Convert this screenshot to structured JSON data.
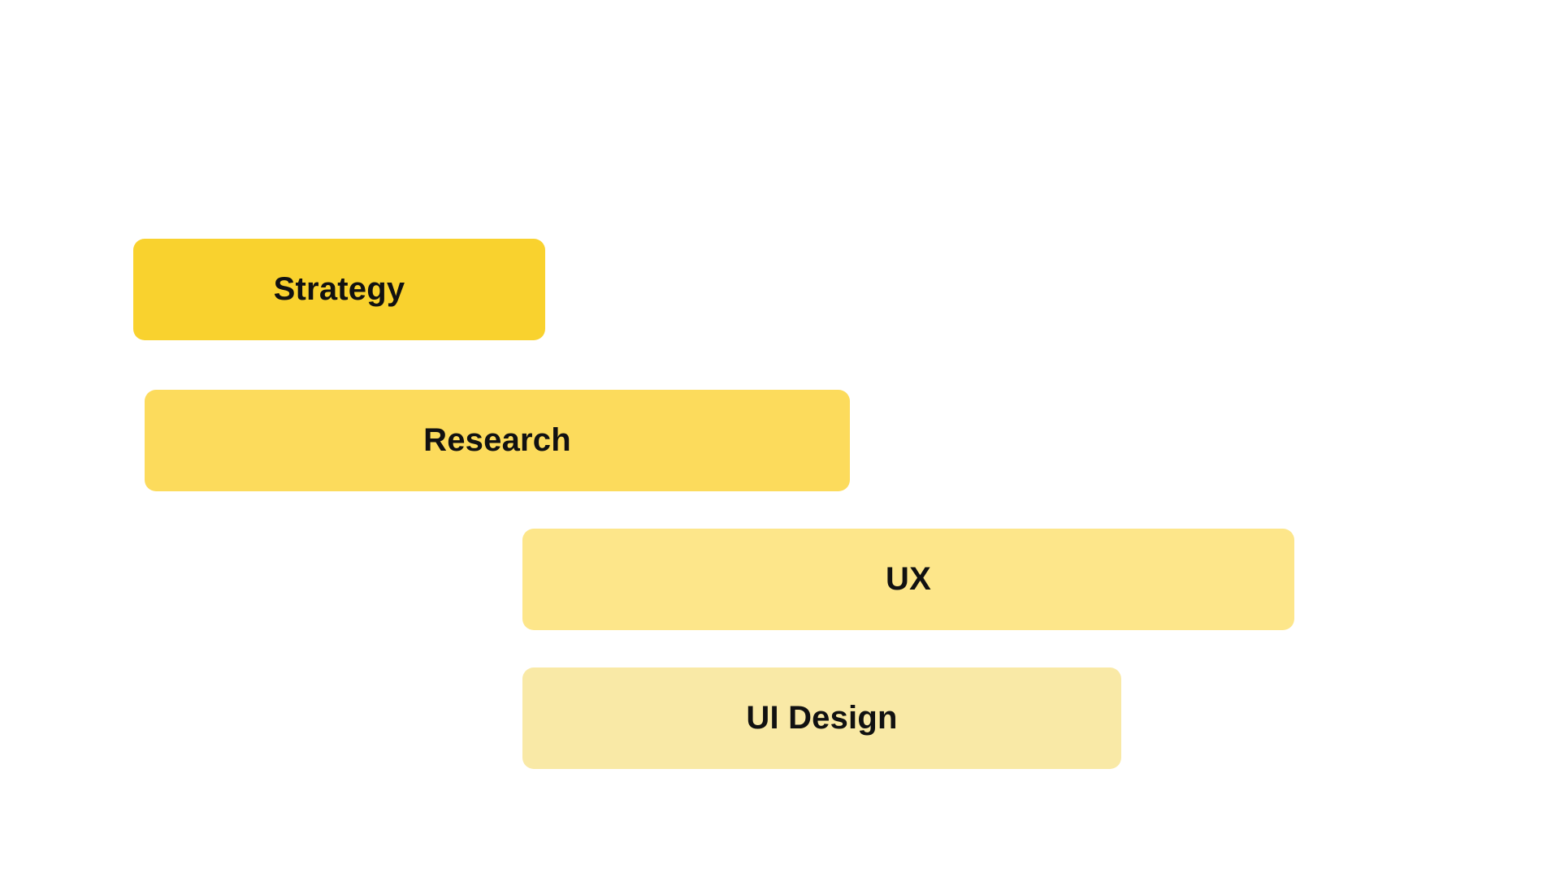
{
  "phases": [
    {
      "label": "Strategy",
      "color": "#F9D22E"
    },
    {
      "label": "Research",
      "color": "#FCDB5C"
    },
    {
      "label": "UX",
      "color": "#FDE68A"
    },
    {
      "label": "UI Design",
      "color": "#F9E9A6"
    }
  ]
}
